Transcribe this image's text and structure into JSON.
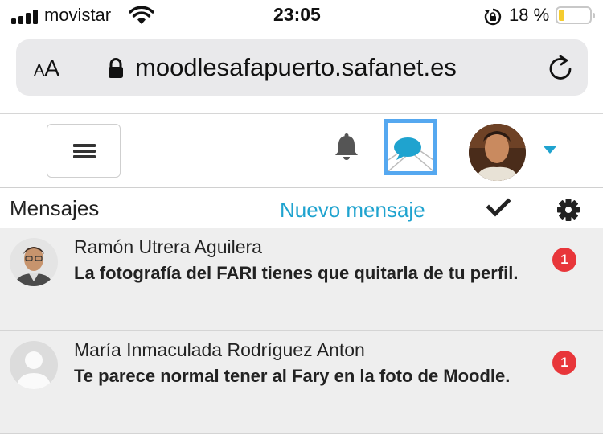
{
  "status_bar": {
    "carrier": "movistar",
    "time": "23:05",
    "battery_text": "18 %",
    "battery_level": 0.18,
    "battery_color": "#f5cc2f"
  },
  "browser": {
    "text_size_label_small": "A",
    "text_size_label_large": "A",
    "url": "moodlesafapuerto.safanet.es",
    "icons": [
      "lock-icon",
      "reload-icon"
    ]
  },
  "navbar": {
    "icons": [
      "hamburger-menu-icon",
      "bell-icon",
      "message-icon",
      "user-avatar",
      "caret-down-icon"
    ],
    "accent_color": "#1fa3cf",
    "focus_color": "#55a8f0"
  },
  "messages": {
    "title": "Mensajes",
    "new_message_label": "Nuevo mensaje",
    "items": [
      {
        "sender": "Ramón Utrera Aguilera",
        "preview": "La fotografía del FARI tienes que quitarla de tu perfil.",
        "unread": "1"
      },
      {
        "sender": "María Inmaculada Rodríguez Anton",
        "preview": "Te parece normal tener al Fary en la foto de Moodle.",
        "unread": "1"
      }
    ],
    "badge_color": "#e8363a"
  }
}
